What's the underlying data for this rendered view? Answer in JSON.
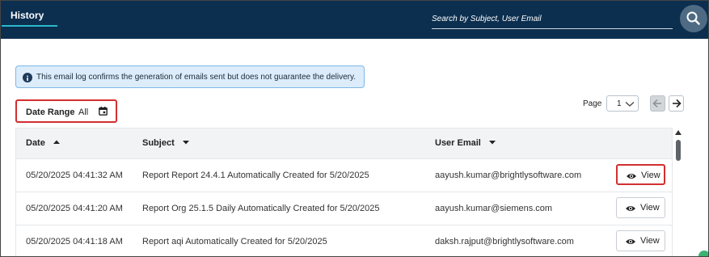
{
  "header": {
    "tab_label": "History",
    "search_placeholder": "Search by Subject, User Email",
    "search_button_icon": "search-icon"
  },
  "info": {
    "icon": "info-icon",
    "text": "This email log confirms the generation of emails sent but does not guarantee the delivery."
  },
  "filters": {
    "date_range_label": "Date Range",
    "date_range_value": "All",
    "calendar_icon": "calendar-icon"
  },
  "pagination": {
    "page_label": "Page",
    "current_page": "1",
    "prev_icon": "arrow-left-icon",
    "next_icon": "arrow-right-icon"
  },
  "table": {
    "columns": [
      {
        "label": "Date",
        "sort": "ascending"
      },
      {
        "label": "Subject",
        "sort": "dropdown"
      },
      {
        "label": "User Email",
        "sort": "dropdown"
      }
    ],
    "rows": [
      {
        "date": "05/20/2025 04:41:32 AM",
        "subject": "Report Report 24.4.1 Automatically Created for 5/20/2025",
        "email": "aayush.kumar@brightlysoftware.com",
        "action": "View",
        "highlighted": true
      },
      {
        "date": "05/20/2025 04:41:20 AM",
        "subject": "Report Org 25.1.5 Daily Automatically Created for 5/20/2025",
        "email": "aayush.kumar@siemens.com",
        "action": "View",
        "highlighted": false
      },
      {
        "date": "05/20/2025 04:41:18 AM",
        "subject": "Report aqi Automatically Created for 5/20/2025",
        "email": "daksh.rajput@brightlysoftware.com",
        "action": "View",
        "highlighted": false
      }
    ]
  },
  "colors": {
    "header_bg": "#0c2f4f",
    "tab_accent": "#2ab7c9",
    "highlight_border": "#d32f2f",
    "info_bg": "#dcecfa"
  }
}
